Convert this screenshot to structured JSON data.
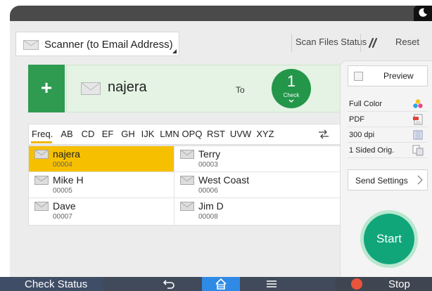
{
  "function_select": {
    "label": "Scanner (to Email Address)",
    "icon": "envelope-icon"
  },
  "header": {
    "scan_files_status": "Scan Files Status",
    "reset": "Reset",
    "clear_icon": "clear-slash-icon"
  },
  "destination": {
    "name": "najera",
    "to_label": "To",
    "count": "1",
    "check_label": "Check"
  },
  "tabs": [
    {
      "label": "Freq.",
      "active": true
    },
    {
      "label": "AB"
    },
    {
      "label": "CD"
    },
    {
      "label": "EF"
    },
    {
      "label": "GH"
    },
    {
      "label": "IJK"
    },
    {
      "label": "LMN"
    },
    {
      "label": "OPQ"
    },
    {
      "label": "RST"
    },
    {
      "label": "UVW"
    },
    {
      "label": "XYZ"
    }
  ],
  "addresses": [
    {
      "name": "najera",
      "number": "00004",
      "selected": true
    },
    {
      "name": "Terry",
      "number": "00003"
    },
    {
      "name": "Mike H",
      "number": "00005"
    },
    {
      "name": "West Coast",
      "number": "00006"
    },
    {
      "name": "Dave",
      "number": "00007"
    },
    {
      "name": "Jim D",
      "number": "00008"
    }
  ],
  "settings": {
    "preview": "Preview",
    "color": "Full Color",
    "format": "PDF",
    "resolution": "300 dpi",
    "sides": "1 Sided Orig.",
    "send_settings": "Send Settings",
    "start": "Start"
  },
  "bottom_bar": {
    "check_status": "Check Status",
    "stop": "Stop"
  },
  "colors": {
    "green": "#2e9b51",
    "selected_row": "#f6c000",
    "start": "#10a67a",
    "home": "#2f8ae5",
    "stop": "#e8543c"
  }
}
